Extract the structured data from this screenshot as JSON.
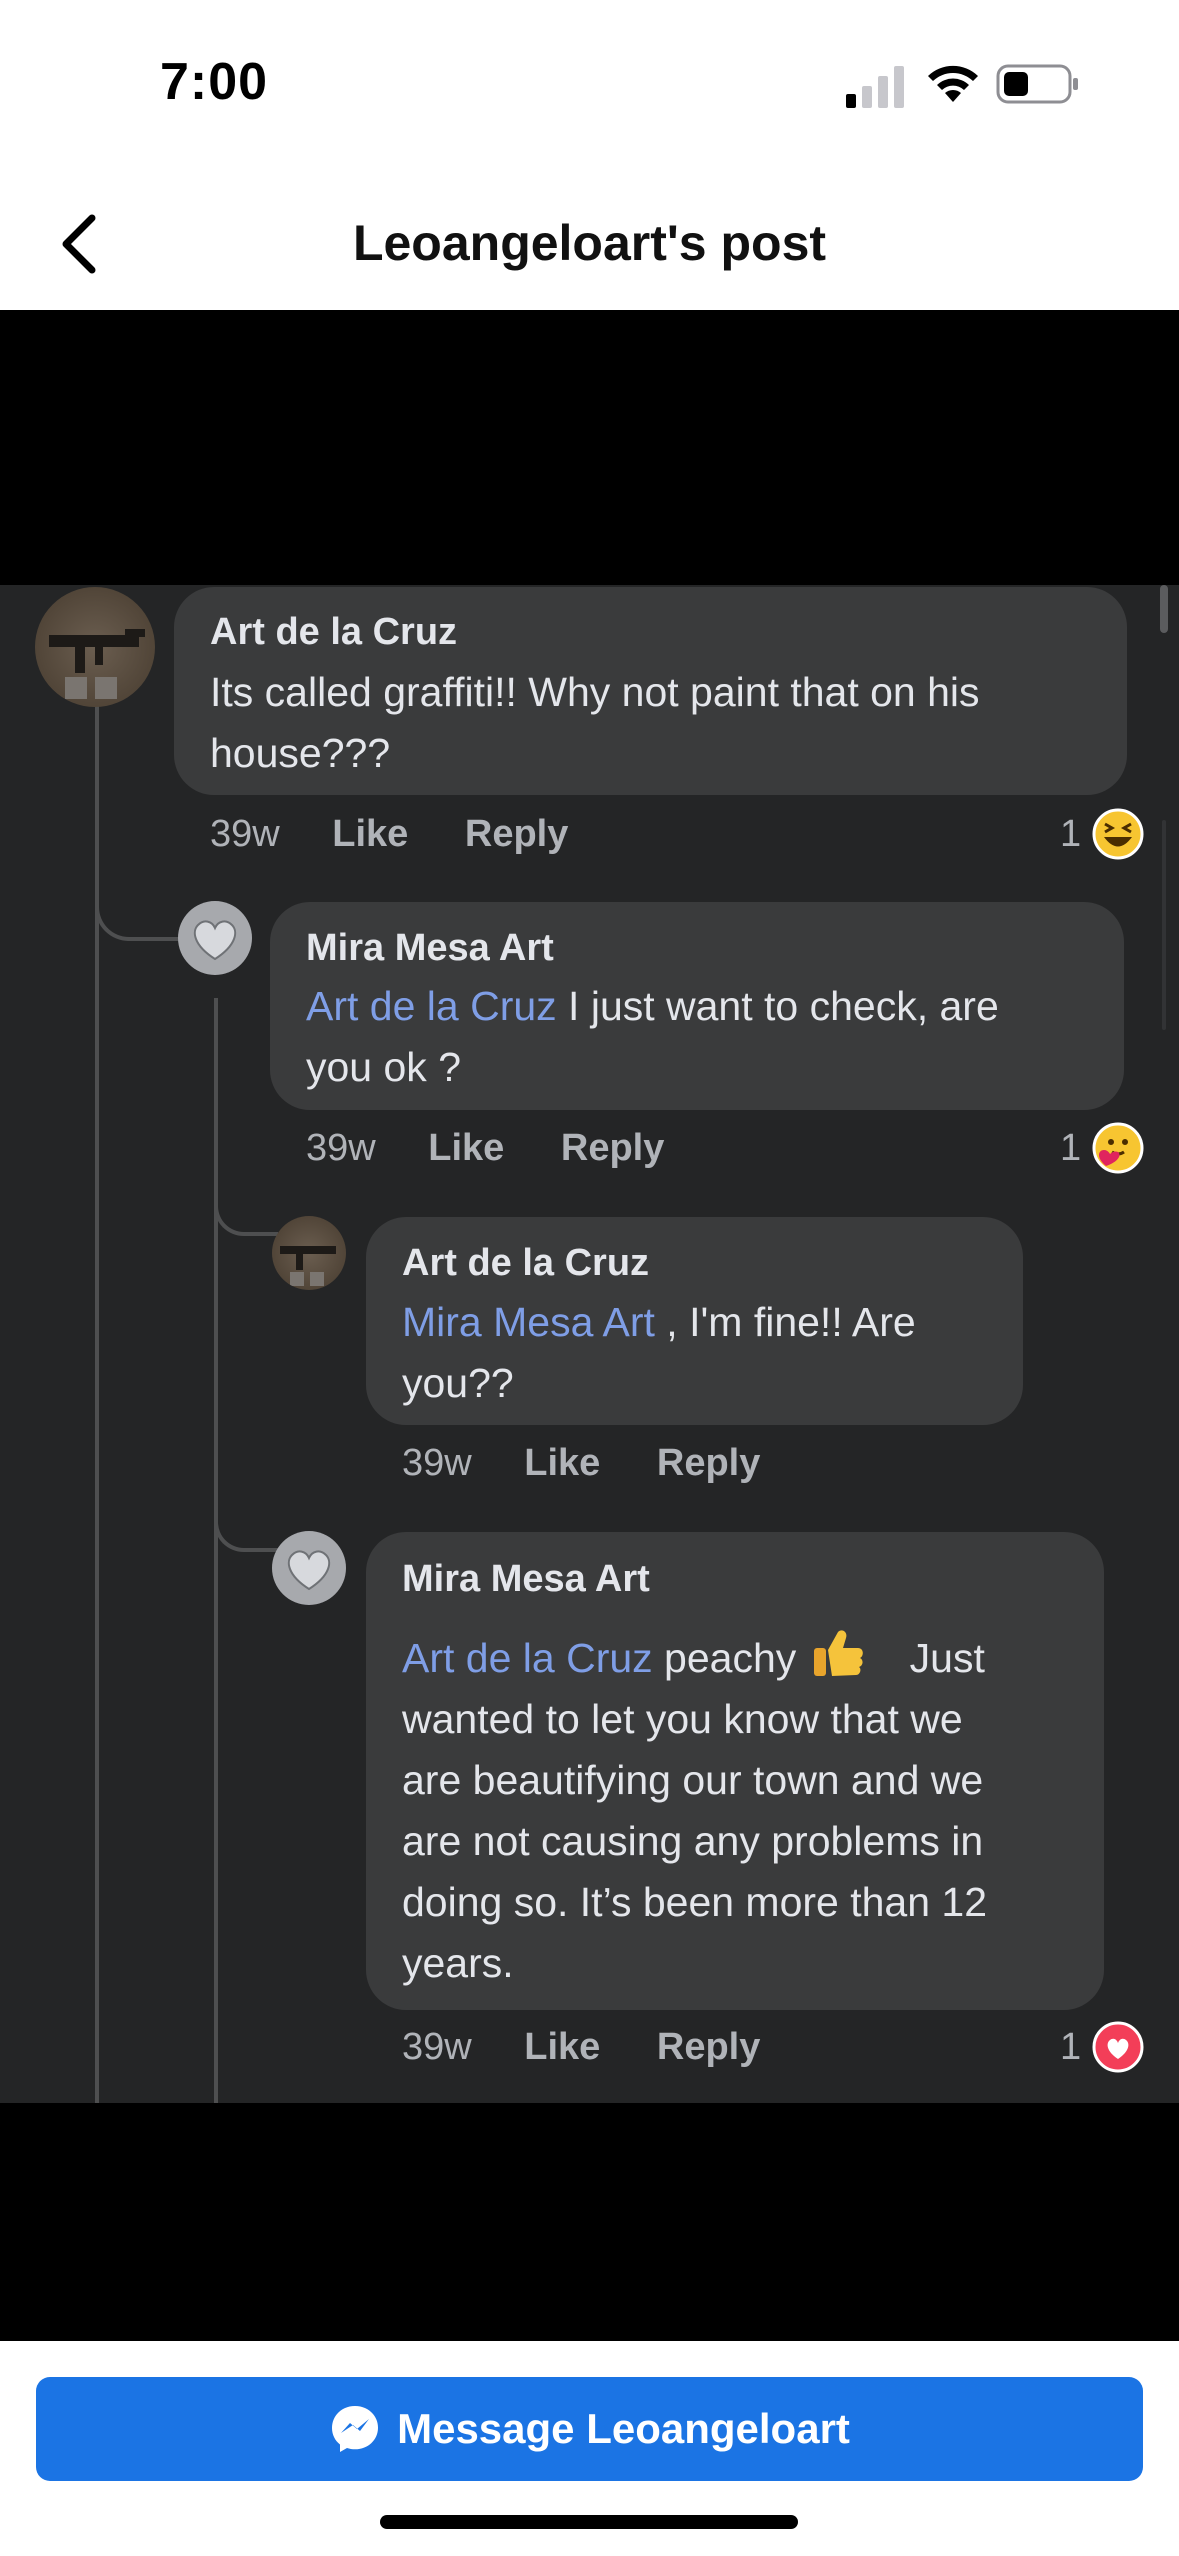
{
  "status_bar": {
    "time": "7:00"
  },
  "nav": {
    "title": "Leoangeloart's post"
  },
  "comments": [
    {
      "author": "Art de la Cruz",
      "line1": "Its called graffiti!! Why not paint that on his",
      "line2": "house???",
      "time": "39w",
      "like": "Like",
      "reply": "Reply",
      "reaction_count": "1",
      "reaction_icon": "laughing-emoji"
    },
    {
      "author": "Mira Mesa Art",
      "mention": "Art de la Cruz",
      "line1_rest": " I just want to check, are",
      "line2": "you ok ?",
      "time": "39w",
      "like": "Like",
      "reply": "Reply",
      "reaction_count": "1",
      "reaction_icon": "care-emoji"
    },
    {
      "author": "Art de la Cruz",
      "mention": "Mira Mesa Art",
      "line1_rest": " , I'm fine!! Are",
      "line2": "you??",
      "time": "39w",
      "like": "Like",
      "reply": "Reply"
    },
    {
      "author": "Mira Mesa Art",
      "mention": "Art de la Cruz",
      "line1_rest": " peachy ",
      "line1_end": "Just",
      "line2": "wanted to let you know that we",
      "line3": "are beautifying our town and we",
      "line4": "are not causing any problems in",
      "line5": "doing so.  It’s been more than 12",
      "line6": "years.",
      "time": "39w",
      "like": "Like",
      "reply": "Reply",
      "reaction_count": "1",
      "reaction_icon": "love-emoji"
    }
  ],
  "bottom": {
    "button_label": "Message Leoangeloart"
  },
  "colors": {
    "button": "#1b74e4",
    "mention": "#7f9ee6",
    "bubble": "#3a3b3c",
    "background": "#242526"
  }
}
